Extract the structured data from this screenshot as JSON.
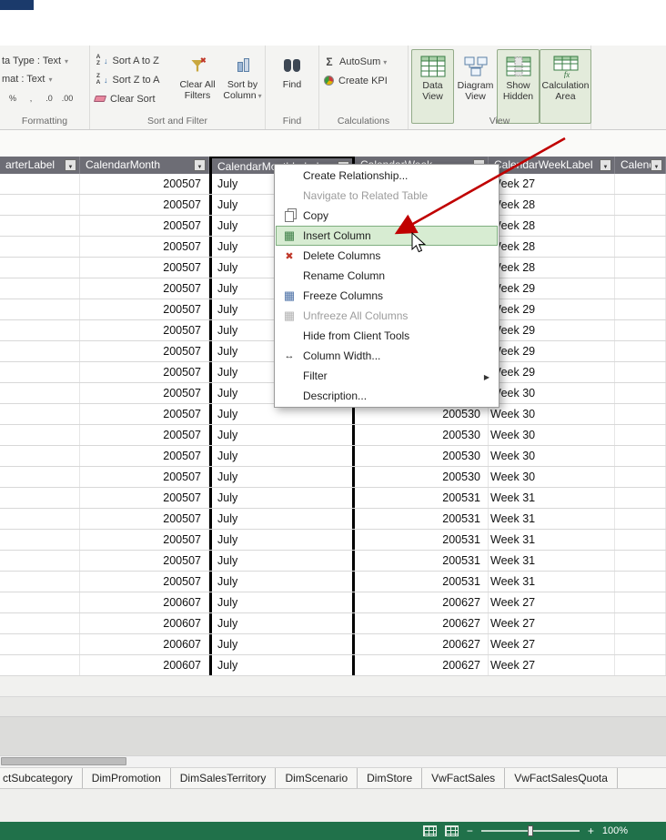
{
  "ribbon": {
    "formatting": {
      "data_type": "ta Type : Text",
      "format": "mat : Text",
      "mini_buttons": [
        "%",
        ",",
        ".0",
        ".00"
      ],
      "group_label": "Formatting"
    },
    "sort_filter": {
      "sort_az": "Sort A to Z",
      "sort_za": "Sort Z to A",
      "clear_sort": "Clear Sort",
      "clear_filters": [
        "Clear All",
        "Filters"
      ],
      "sort_by_column": [
        "Sort by",
        "Column"
      ],
      "group_label": "Sort and Filter"
    },
    "find": {
      "find": "Find",
      "group_label": "Find"
    },
    "calculations": {
      "autosum": "AutoSum",
      "create_kpi": "Create KPI",
      "group_label": "Calculations"
    },
    "view": {
      "buttons": [
        {
          "label": [
            "Data",
            "View"
          ],
          "icon": "data-view",
          "active": true
        },
        {
          "label": [
            "Diagram",
            "View"
          ],
          "icon": "diagram-view",
          "active": false
        },
        {
          "label": [
            "Show",
            "Hidden"
          ],
          "icon": "show-hidden",
          "active": true
        },
        {
          "label": [
            "Calculation",
            "Area"
          ],
          "icon": "calculation-area",
          "active": true
        }
      ],
      "group_label": "View"
    }
  },
  "grid": {
    "headers": [
      {
        "label": "arterLabel"
      },
      {
        "label": "CalendarMonth"
      },
      {
        "label": "CalendarMonthLabel",
        "selected": true
      },
      {
        "label": "CalendarWeek"
      },
      {
        "label": "CalendarWeekLabel"
      },
      {
        "label": "Calenda"
      }
    ],
    "rows": [
      [
        "200507",
        "July",
        "",
        "Week 27"
      ],
      [
        "200507",
        "July",
        "",
        "Week 28"
      ],
      [
        "200507",
        "July",
        "",
        "Week 28"
      ],
      [
        "200507",
        "July",
        "",
        "Week 28"
      ],
      [
        "200507",
        "July",
        "",
        "Week 28"
      ],
      [
        "200507",
        "July",
        "",
        "Week 29"
      ],
      [
        "200507",
        "July",
        "",
        "Week 29"
      ],
      [
        "200507",
        "July",
        "",
        "Week 29"
      ],
      [
        "200507",
        "July",
        "",
        "Week 29"
      ],
      [
        "200507",
        "July",
        "",
        "Week 29"
      ],
      [
        "200507",
        "July",
        "",
        "Week 30"
      ],
      [
        "200507",
        "July",
        "200530",
        "Week 30"
      ],
      [
        "200507",
        "July",
        "200530",
        "Week 30"
      ],
      [
        "200507",
        "July",
        "200530",
        "Week 30"
      ],
      [
        "200507",
        "July",
        "200530",
        "Week 30"
      ],
      [
        "200507",
        "July",
        "200531",
        "Week 31"
      ],
      [
        "200507",
        "July",
        "200531",
        "Week 31"
      ],
      [
        "200507",
        "July",
        "200531",
        "Week 31"
      ],
      [
        "200507",
        "July",
        "200531",
        "Week 31"
      ],
      [
        "200507",
        "July",
        "200531",
        "Week 31"
      ],
      [
        "200607",
        "July",
        "200627",
        "Week 27"
      ],
      [
        "200607",
        "July",
        "200627",
        "Week 27"
      ],
      [
        "200607",
        "July",
        "200627",
        "Week 27"
      ],
      [
        "200607",
        "July",
        "200627",
        "Week 27"
      ]
    ]
  },
  "context_menu": {
    "items": [
      {
        "label": "Create Relationship...",
        "icon": ""
      },
      {
        "label": "Navigate to Related Table",
        "icon": "",
        "disabled": true
      },
      {
        "label": "Copy",
        "icon": "copy"
      },
      {
        "label": "Insert Column",
        "icon": "insert",
        "highlighted": true
      },
      {
        "label": "Delete Columns",
        "icon": "delete"
      },
      {
        "label": "Rename Column",
        "icon": ""
      },
      {
        "label": "Freeze Columns",
        "icon": "freeze"
      },
      {
        "label": "Unfreeze All Columns",
        "icon": "unfreeze",
        "disabled": true
      },
      {
        "label": "Hide from Client Tools",
        "icon": ""
      },
      {
        "label": "Column Width...",
        "icon": "width"
      },
      {
        "label": "Filter",
        "icon": "",
        "submenu": true
      },
      {
        "label": "Description...",
        "icon": ""
      }
    ]
  },
  "tabs": [
    "ctSubcategory",
    "DimPromotion",
    "DimSalesTerritory",
    "DimScenario",
    "DimStore",
    "VwFactSales",
    "VwFactSalesQuota"
  ],
  "statusbar": {
    "zoom": "100%"
  }
}
